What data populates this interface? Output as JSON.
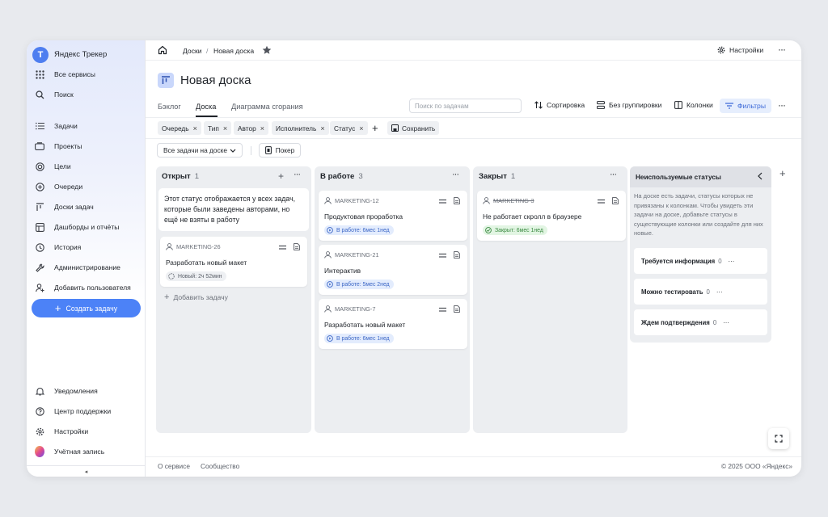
{
  "sidebar": {
    "brand": "Яндекс Трекер",
    "logo_letter": "Т",
    "all_services": "Все сервисы",
    "search": "Поиск",
    "items": [
      {
        "label": "Задачи",
        "icon": "tasks-icon"
      },
      {
        "label": "Проекты",
        "icon": "projects-icon"
      },
      {
        "label": "Цели",
        "icon": "goals-icon"
      },
      {
        "label": "Очереди",
        "icon": "queues-icon"
      },
      {
        "label": "Доски задач",
        "icon": "boards-icon"
      },
      {
        "label": "Дашборды и отчёты",
        "icon": "dashboards-icon"
      },
      {
        "label": "История",
        "icon": "history-icon"
      },
      {
        "label": "Администрирование",
        "icon": "admin-icon"
      },
      {
        "label": "Добавить пользователя",
        "icon": "add-user-icon"
      }
    ],
    "create_task": "Создать задачу",
    "bottom": [
      {
        "label": "Уведомления",
        "icon": "bell-icon"
      },
      {
        "label": "Центр поддержки",
        "icon": "help-icon"
      },
      {
        "label": "Настройки",
        "icon": "gear-icon"
      },
      {
        "label": "Учётная запись",
        "icon": "avatar"
      }
    ],
    "collapse": "◂"
  },
  "topbar": {
    "crumb_boards": "Доски",
    "crumb_sep": "/",
    "crumb_current": "Новая доска",
    "settings": "Настройки"
  },
  "page": {
    "title": "Новая доска",
    "tabs": [
      "Бэклог",
      "Доска",
      "Диаграмма сгорания"
    ],
    "active_tab": "Доска",
    "search_placeholder": "Поиск по задачам",
    "sort": "Сортировка",
    "grouping": "Без группировки",
    "columns": "Колонки",
    "filters": "Фильтры"
  },
  "filter_chips": [
    "Очередь",
    "Тип",
    "Автор",
    "Исполнитель",
    "Статус"
  ],
  "save_label": "Сохранить",
  "view_select": "Все задачи на доске",
  "poker": "Покер",
  "columns": [
    {
      "name": "Открыт",
      "count": "1",
      "notice": "Этот статус отображается у всех задач, которые были заведены авторами, но ещё не взяты в работу",
      "cards": [
        {
          "key": "MARKETING-26",
          "title": "Разработать новый макет",
          "status": "Новый: 2ч 52мин",
          "status_kind": "grey"
        }
      ],
      "add_task": "Добавить задачу"
    },
    {
      "name": "В работе",
      "count": "3",
      "cards": [
        {
          "key": "MARKETING-12",
          "title": "Продуктовая проработка",
          "status": "В работе: 6мес 1нед",
          "status_kind": "blue"
        },
        {
          "key": "MARKETING-21",
          "title": "Интерактив",
          "status": "В работе: 5мес 2нед",
          "status_kind": "blue"
        },
        {
          "key": "MARKETING-7",
          "title": "Разработать новый макет",
          "status": "В работе: 6мес 1нед",
          "status_kind": "blue"
        }
      ]
    },
    {
      "name": "Закрыт",
      "count": "1",
      "cards": [
        {
          "key": "MARKETING-3",
          "title": "Не работает скролл в браузере",
          "status": "Закрыт: 6мес 1нед",
          "status_kind": "green"
        }
      ]
    }
  ],
  "unused": {
    "title": "Неиспользуемые статусы",
    "description": "На доске есть задачи, статусы которых не привязаны к колонкам. Чтобы увидеть эти задачи на доске, добавьте статусы в существующие колонки или создайте для них новые.",
    "statuses": [
      {
        "name": "Требуется информация",
        "count": "0"
      },
      {
        "name": "Можно тестировать",
        "count": "0"
      },
      {
        "name": "Ждем подтверждения",
        "count": "0"
      }
    ]
  },
  "footer": {
    "about": "О сервисе",
    "community": "Сообщество",
    "copyright": "© 2025 ООО «Яндекс»"
  },
  "colors": {
    "accent": "#4c82f7",
    "sidebar_top": "#e3e9fb",
    "status_blue": "#3c67c6",
    "status_green": "#3a8a41"
  }
}
